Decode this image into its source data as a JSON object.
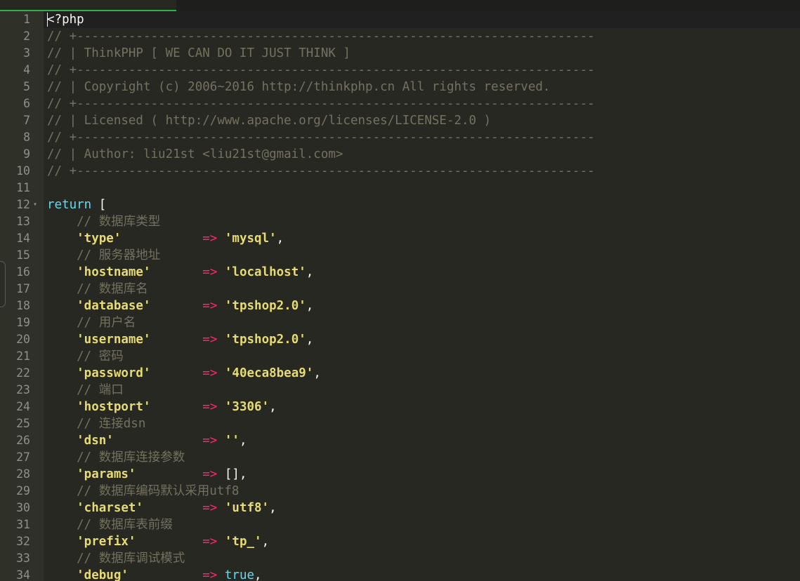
{
  "editor": {
    "colors": {
      "background": "#272822",
      "gutter": "#2f3129",
      "comment": "#75715e",
      "string": "#e6db74",
      "keyword": "#66d9ef",
      "operator": "#f92672",
      "text": "#f8f8f2",
      "tab_indicator": "#2fb34a"
    },
    "lines": [
      {
        "num": "1",
        "text": "<?php"
      },
      {
        "num": "2",
        "comment": "// +----------------------------------------------------------------------"
      },
      {
        "num": "3",
        "comment": "// | ThinkPHP [ WE CAN DO IT JUST THINK ]"
      },
      {
        "num": "4",
        "comment": "// +----------------------------------------------------------------------"
      },
      {
        "num": "5",
        "comment": "// | Copyright (c) 2006~2016 http://thinkphp.cn All rights reserved."
      },
      {
        "num": "6",
        "comment": "// +----------------------------------------------------------------------"
      },
      {
        "num": "7",
        "comment": "// | Licensed ( http://www.apache.org/licenses/LICENSE-2.0 )"
      },
      {
        "num": "8",
        "comment": "// +----------------------------------------------------------------------"
      },
      {
        "num": "9",
        "comment": "// | Author: liu21st <liu21st@gmail.com>"
      },
      {
        "num": "10",
        "comment": "// +----------------------------------------------------------------------"
      },
      {
        "num": "11"
      },
      {
        "num": "12",
        "keyword": "return",
        "text": " [",
        "fold": "▾"
      },
      {
        "num": "13",
        "comment": "    // 数据库类型"
      },
      {
        "num": "14",
        "key": "    'type'",
        "pad": "           ",
        "op": "=>",
        "val": " 'mysql'",
        "tail": ","
      },
      {
        "num": "15",
        "comment": "    // 服务器地址"
      },
      {
        "num": "16",
        "key": "    'hostname'",
        "pad": "       ",
        "op": "=>",
        "val": " 'localhost'",
        "tail": ","
      },
      {
        "num": "17",
        "comment": "    // 数据库名"
      },
      {
        "num": "18",
        "key": "    'database'",
        "pad": "       ",
        "op": "=>",
        "val": " 'tpshop2.0'",
        "tail": ","
      },
      {
        "num": "19",
        "comment": "    // 用户名"
      },
      {
        "num": "20",
        "key": "    'username'",
        "pad": "       ",
        "op": "=>",
        "val": " 'tpshop2.0'",
        "tail": ","
      },
      {
        "num": "21",
        "comment": "    // 密码"
      },
      {
        "num": "22",
        "key": "    'password'",
        "pad": "       ",
        "op": "=>",
        "val": " '40eca8bea9'",
        "tail": ","
      },
      {
        "num": "23",
        "comment": "    // 端口"
      },
      {
        "num": "24",
        "key": "    'hostport'",
        "pad": "       ",
        "op": "=>",
        "val": " '3306'",
        "tail": ","
      },
      {
        "num": "25",
        "comment": "    // 连接dsn"
      },
      {
        "num": "26",
        "key": "    'dsn'",
        "pad": "            ",
        "op": "=>",
        "val": " ''",
        "tail": ","
      },
      {
        "num": "27",
        "comment": "    // 数据库连接参数"
      },
      {
        "num": "28",
        "key": "    'params'",
        "pad": "         ",
        "op": "=>",
        "text": " [],"
      },
      {
        "num": "29",
        "comment": "    // 数据库编码默认采用utf8"
      },
      {
        "num": "30",
        "key": "    'charset'",
        "pad": "        ",
        "op": "=>",
        "val": " 'utf8'",
        "tail": ","
      },
      {
        "num": "31",
        "comment": "    // 数据库表前缀"
      },
      {
        "num": "32",
        "key": "    'prefix'",
        "pad": "         ",
        "op": "=>",
        "val": " 'tp_'",
        "tail": ","
      },
      {
        "num": "33",
        "comment": "    // 数据库调试模式"
      },
      {
        "num": "34",
        "key": "    'debug'",
        "pad": "          ",
        "op": "=>",
        "kw2": " true",
        "tail": ","
      }
    ]
  }
}
